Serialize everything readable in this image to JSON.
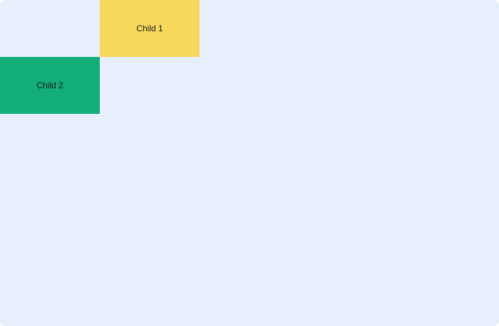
{
  "children": [
    {
      "label": "Child 1",
      "color": "#f6d95b"
    },
    {
      "label": "Child 2",
      "color": "#12ad79"
    }
  ],
  "container": {
    "background": "#e7effd"
  }
}
